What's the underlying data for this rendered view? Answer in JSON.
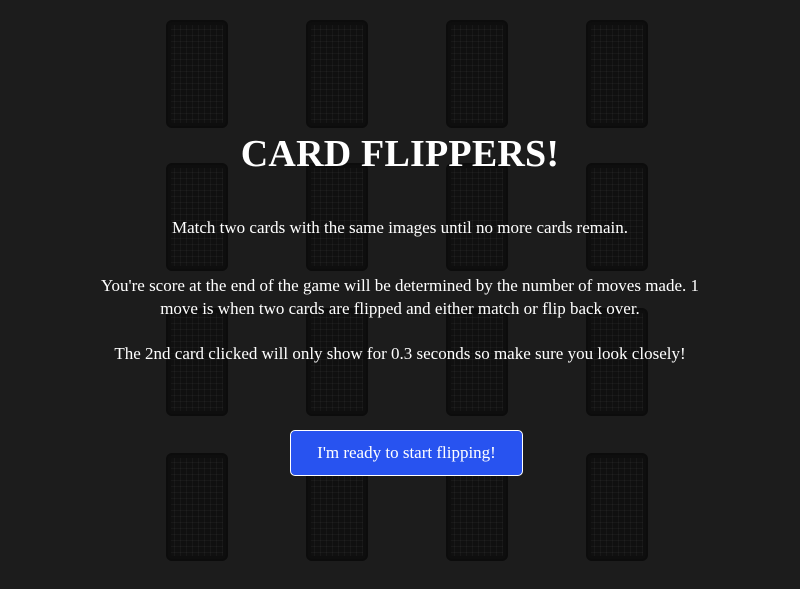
{
  "game": {
    "title": "CARD FLIPPERS!",
    "instructions": [
      "Match two cards with the same images until no more cards remain.",
      "You're score at the end of the game will be determined by the number of moves made. 1 move is when two cards are flipped and either match or flip back over.",
      "The 2nd card clicked will only show for 0.3 seconds so make sure you look closely!"
    ],
    "start_button_label": "I'm ready to start flipping!"
  },
  "board": {
    "rows": 4,
    "columns": 4,
    "card_state": "face-down"
  },
  "colors": {
    "background": "#1c1c1c",
    "card_back": "#101010",
    "button": "#2853f0",
    "text": "#ffffff"
  }
}
